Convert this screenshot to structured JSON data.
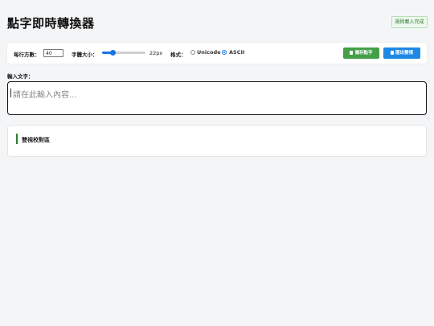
{
  "header": {
    "title": "點字即時轉換器",
    "status_badge": "規則載入完成"
  },
  "toolbar": {
    "cols_label": "每行方數：",
    "cols_value": "40",
    "size_label": "字體大小：",
    "size_value": "22px",
    "format_label": "格式：",
    "format_options": [
      {
        "label": "Unicode",
        "checked": false
      },
      {
        "label": "ASCII",
        "checked": true
      }
    ],
    "save_label": "儲存點字",
    "export_label": "匯出雙視"
  },
  "input": {
    "caption": "輸入文字：",
    "placeholder": "請在此輸入內容..."
  },
  "preview": {
    "title": "雙視校對區"
  },
  "colors": {
    "accent": "#1a73e8",
    "save": "#43a047",
    "export": "#1e88e5",
    "preview_bar": "#2e7d32"
  }
}
